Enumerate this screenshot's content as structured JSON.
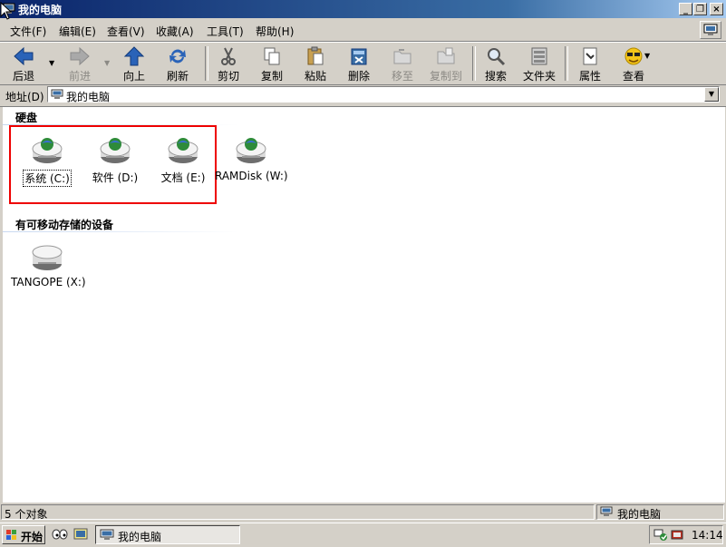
{
  "window": {
    "title": "我的电脑",
    "controls": {
      "minimize": "_",
      "restore": "❐",
      "close": "×"
    }
  },
  "menu": [
    "文件(F)",
    "编辑(E)",
    "查看(V)",
    "收藏(A)",
    "工具(T)",
    "帮助(H)"
  ],
  "toolbar": {
    "back": "后退",
    "forward": "前进",
    "up": "向上",
    "refresh": "刷新",
    "cut": "剪切",
    "copy": "复制",
    "paste": "粘贴",
    "delete": "删除",
    "move_to": "移至",
    "copy_to": "复制到",
    "search": "搜索",
    "folders": "文件夹",
    "properties": "属性",
    "view": "查看"
  },
  "address": {
    "label": "地址(D)",
    "value": "我的电脑"
  },
  "groups": {
    "hard_disks": {
      "title": "硬盘",
      "drives": [
        "系统 (C:)",
        "软件 (D:)",
        "文档 (E:)",
        "RAMDisk (W:)"
      ]
    },
    "removable": {
      "title": "有可移动存储的设备",
      "drives": [
        "TANGOPE (X:)"
      ]
    }
  },
  "status": {
    "count": "5 个对象",
    "location": "我的电脑"
  },
  "taskbar": {
    "start": "开始",
    "task": "我的电脑",
    "clock": "14:14"
  },
  "colors": {
    "titlebar": "#0a246a",
    "highlight_box": "#e00000",
    "face": "#d4d0c8"
  }
}
